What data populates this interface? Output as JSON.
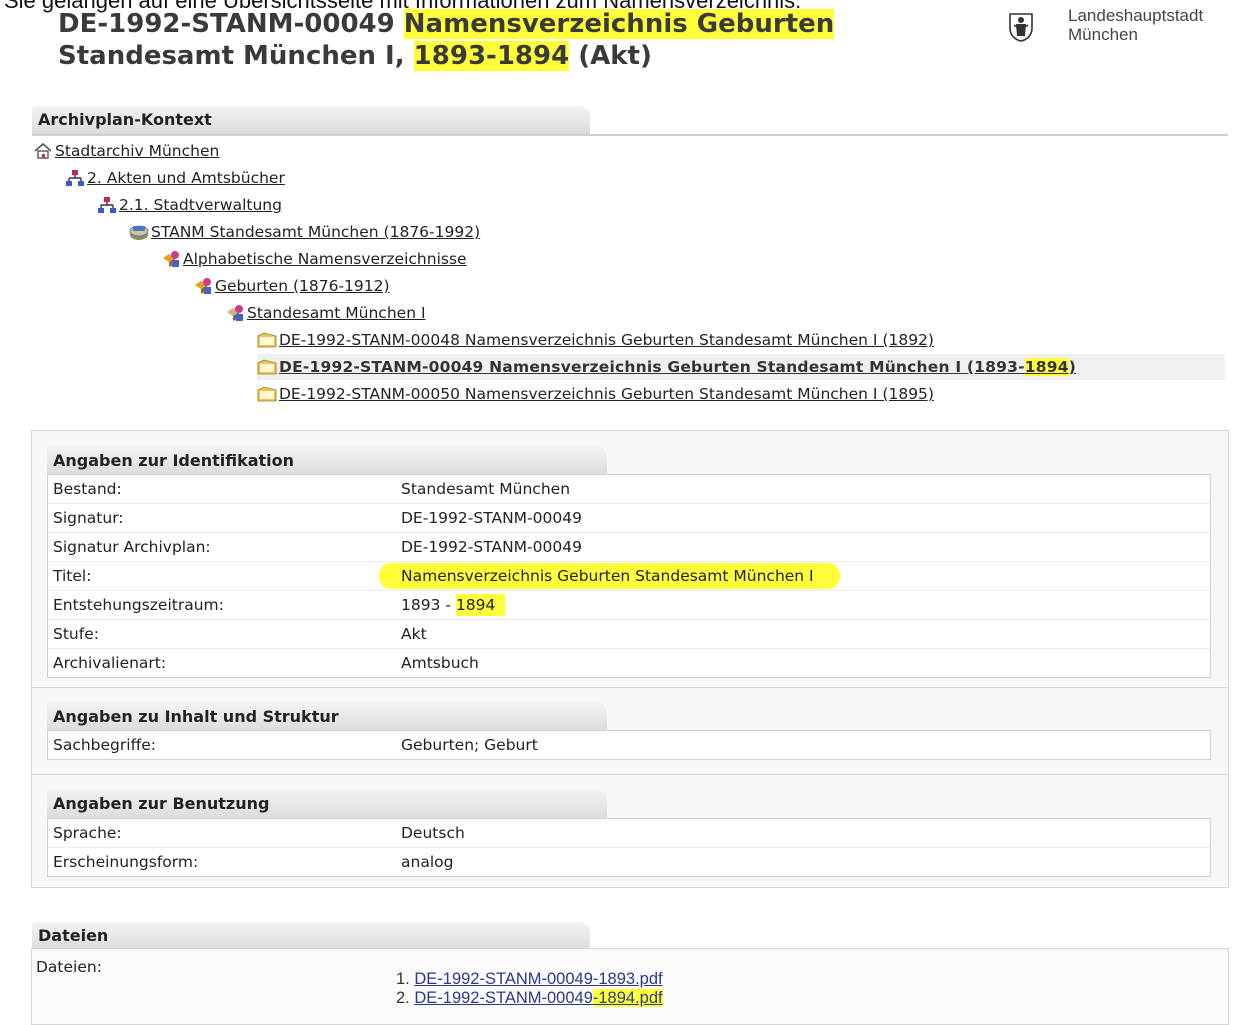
{
  "note": "Sie gelangen auf eine Übersichtsseite mit Informationen zum Namensverzeichnis:",
  "heading": {
    "line1_a": "DE-1992-STANM-00049 ",
    "line1_b": "Namensverzeichnis Geburten",
    "line2_a": "Standesamt München I, ",
    "line2_b": "1893-1894",
    "line2_c": " (Akt)"
  },
  "logo": {
    "line1": "Landeshauptstadt",
    "line2": "München",
    "emblem": "muenchner-kindl-emblem"
  },
  "context": {
    "title": "Archivplan-Kontext",
    "items": [
      {
        "label": "Stadtarchiv München",
        "icon": "home-icon"
      },
      {
        "label": "2. Akten und Amtsbücher",
        "icon": "hierarchy-icon"
      },
      {
        "label": "2.1. Stadtverwaltung",
        "icon": "hierarchy-icon"
      },
      {
        "label": "STANM Standesamt München (1876-1992)",
        "icon": "holding-icon"
      },
      {
        "label": "Alphabetische Namensverzeichnisse",
        "icon": "series-icon"
      },
      {
        "label": "Geburten (1876-1912)",
        "icon": "series-icon"
      },
      {
        "label": "Standesamt München I",
        "icon": "series-icon"
      },
      {
        "label": "DE-1992-STANM-00048 Namensverzeichnis Geburten Standesamt München I (1892)",
        "icon": "folder-icon"
      },
      {
        "label_a": "DE-1992-STANM-00049 Namensverzeichnis Geburten Standesamt München I (1893-",
        "label_b": "1894",
        "label_c": ")",
        "icon": "folder-icon"
      },
      {
        "label": "DE-1992-STANM-00050 Namensverzeichnis Geburten Standesamt München I (1895)",
        "icon": "folder-icon"
      }
    ]
  },
  "identification": {
    "title": "Angaben zur Identifikation",
    "rows": [
      {
        "key": "Bestand:",
        "value": "Standesamt München"
      },
      {
        "key": "Signatur:",
        "value": "DE-1992-STANM-00049"
      },
      {
        "key": "Signatur Archivplan:",
        "value": "DE-1992-STANM-00049"
      },
      {
        "key": "Titel:",
        "value": "Namensverzeichnis Geburten Standesamt München I"
      },
      {
        "key": "Entstehungszeitraum:",
        "value_a": "1893 - ",
        "value_b": "1894"
      },
      {
        "key": "Stufe:",
        "value": "Akt"
      },
      {
        "key": "Archivalienart:",
        "value": "Amtsbuch"
      }
    ]
  },
  "content": {
    "title": "Angaben zu Inhalt und Struktur",
    "rows": [
      {
        "key": "Sachbegriffe:",
        "value": "Geburten; Geburt"
      }
    ]
  },
  "usage": {
    "title": "Angaben zur Benutzung",
    "rows": [
      {
        "key": "Sprache:",
        "value": "Deutsch"
      },
      {
        "key": "Erscheinungsform:",
        "value": "analog"
      }
    ]
  },
  "files": {
    "title": "Dateien",
    "label": "Dateien:",
    "items": [
      {
        "num": "1.",
        "name": "DE-1992-STANM-00049-1893.pdf"
      },
      {
        "num": "2.",
        "name_a": "DE-1992-STANM-00049",
        "name_b": "-1894.pdf"
      }
    ]
  },
  "colors": {
    "highlight": "#ffff3a",
    "link": "#2b3a8c",
    "tab_bg": "#dcdcdc"
  }
}
